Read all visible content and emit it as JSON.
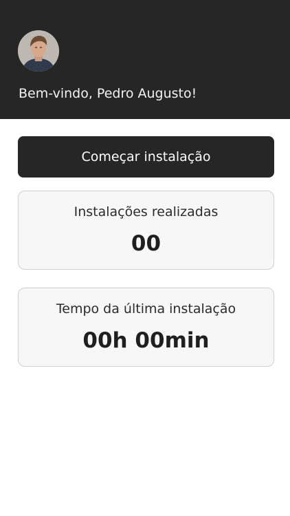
{
  "header": {
    "welcome_text": "Bem-vindo, Pedro Augusto!",
    "background_color": "#262626",
    "avatar_icon": "user-photo"
  },
  "actions": {
    "start_label": "Começar instalação"
  },
  "stats": {
    "installations": {
      "label": "Instalações realizadas",
      "value": "00"
    },
    "last_install_time": {
      "label": "Tempo da última instalação",
      "value": "00h 00min"
    }
  }
}
